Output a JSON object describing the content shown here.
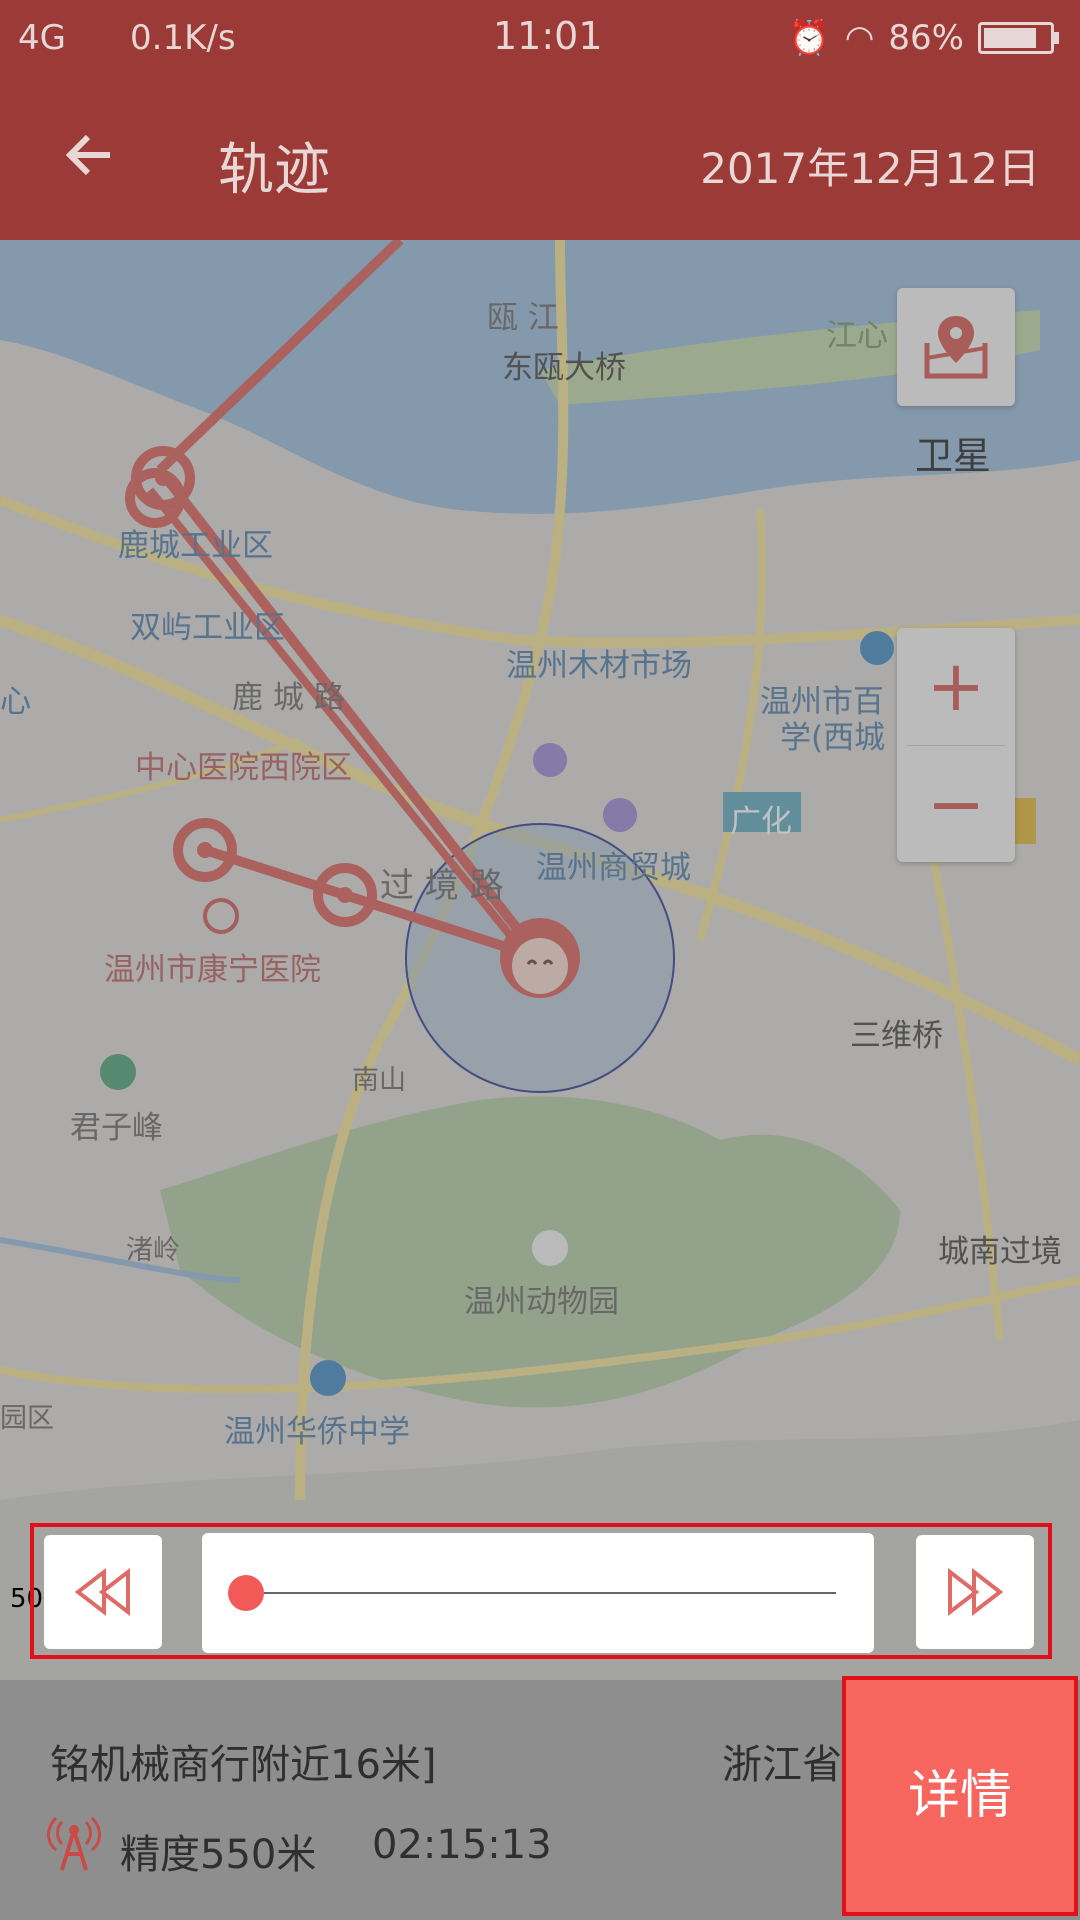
{
  "status_bar": {
    "network": "4G",
    "speed": "0.1K/s",
    "time": "11:01",
    "battery": "86%"
  },
  "header": {
    "back_icon": "arrow-left-icon",
    "title": "轨迹",
    "date": "2017年12月12日"
  },
  "map": {
    "satellite_label": "卫星",
    "zoom_in": "+",
    "zoom_out": "−",
    "labels": {
      "ou_river": "瓯 江",
      "dongou_bridge": "东瓯大桥",
      "jiangxin": "江心",
      "lucheng_industrial": "鹿城工业区",
      "shuangyu_industrial": "双屿工业区",
      "timber_market": "温州木材市场",
      "baizhang": "温州市百",
      "xicheng": "学(西城",
      "lucheng_road": "鹿 城 路",
      "hospital_west": "中心医院西院区",
      "guanghua": "广化",
      "trade_city": "温州商贸城",
      "guojing_road": "过 境 路",
      "kangning_hospital": "温州市康宁医院",
      "sanwei_bridge": "三维桥",
      "nanshan": "南山",
      "junzifeng": "君子峰",
      "zhuling": "渚岭",
      "zoo": "温州动物园",
      "chengnan": "城南过境",
      "huaqiao_school": "温州华侨中学",
      "left_qu": "园区",
      "left_xin": "心"
    }
  },
  "scale_label": "50",
  "playback": {
    "rewind_icon": "rewind-icon",
    "forward_icon": "fast-forward-icon",
    "progress": 0.0
  },
  "info": {
    "address": "铭机械商行附近16米]",
    "province": "浙江省",
    "accuracy": "精度550米",
    "time": "02:15:13",
    "detail_button": "详情"
  }
}
